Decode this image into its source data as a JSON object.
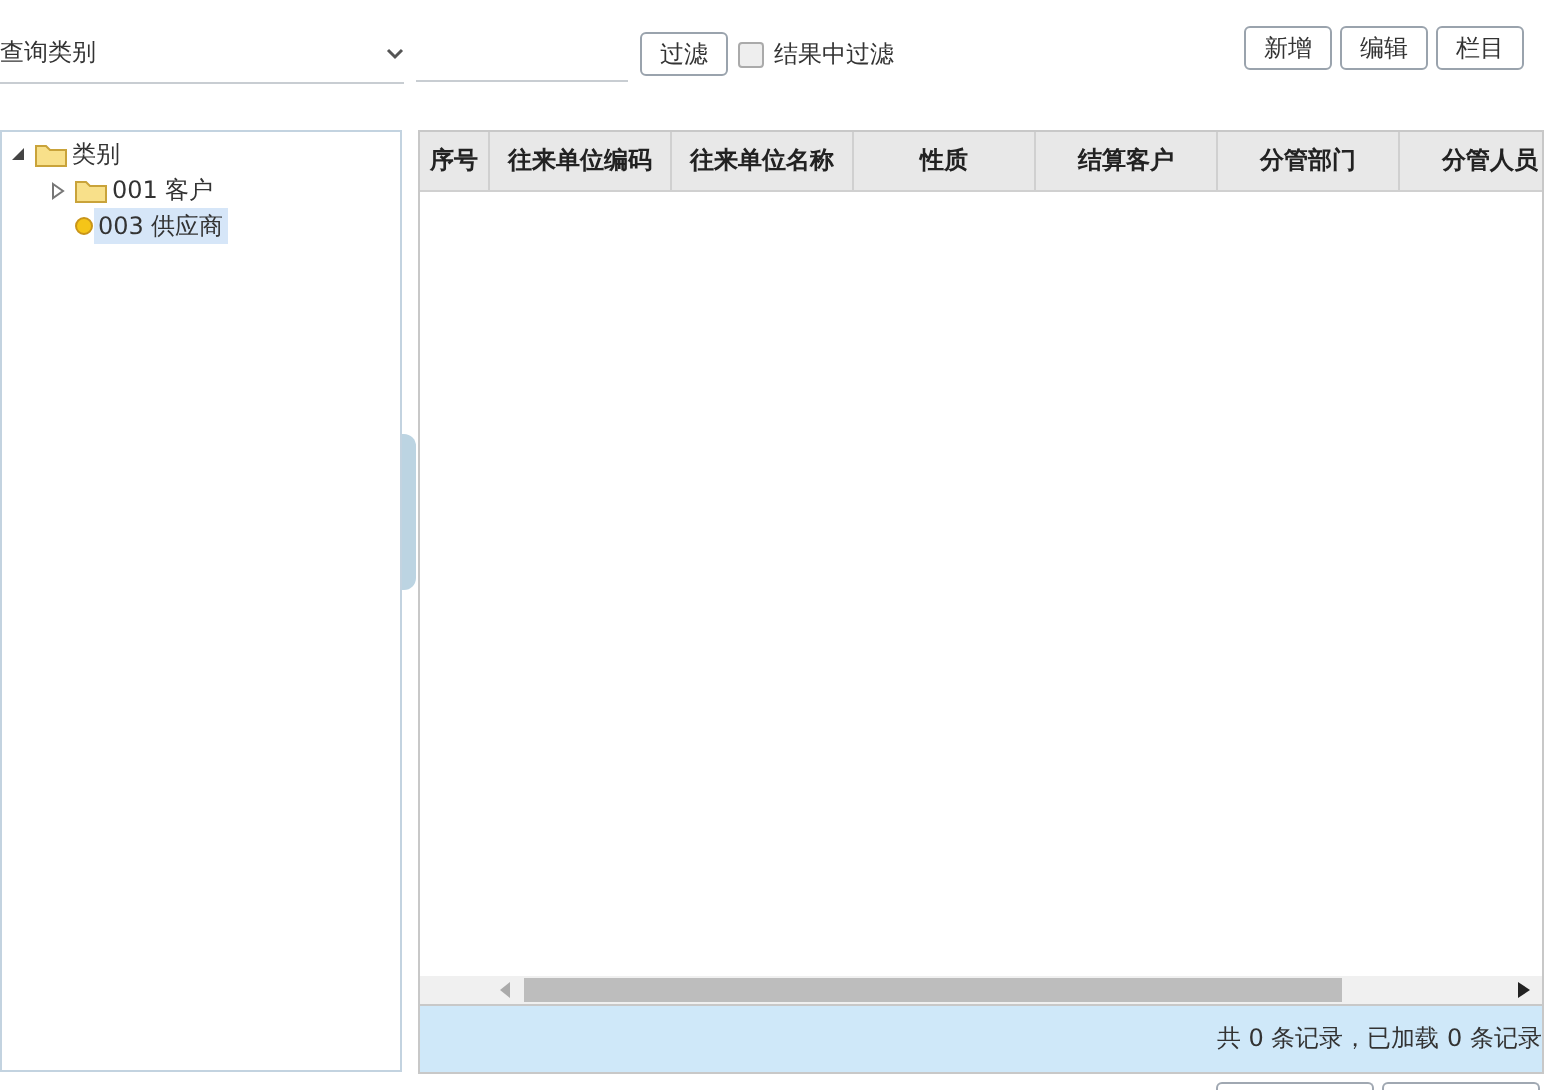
{
  "toolbar": {
    "category_select": {
      "value": "查询类别"
    },
    "filter_button": "过滤",
    "filter_in_results": {
      "label": "结果中过滤",
      "checked": false
    },
    "actions": [
      "新增",
      "编辑",
      "栏目"
    ]
  },
  "tree": [
    {
      "label": "类别",
      "kind": "folder",
      "expanded": true,
      "selected": false,
      "children": [
        {
          "label": "001 客户",
          "kind": "folder",
          "expanded": false,
          "selected": false
        },
        {
          "label": "003 供应商",
          "kind": "leaf",
          "selected": true
        }
      ]
    }
  ],
  "table": {
    "columns": [
      "序号",
      "往来单位编码",
      "往来单位名称",
      "性质",
      "结算客户",
      "分管部门",
      "分管人员"
    ]
  },
  "status_bar": "共 0 条记录，已加载 0 条记录"
}
